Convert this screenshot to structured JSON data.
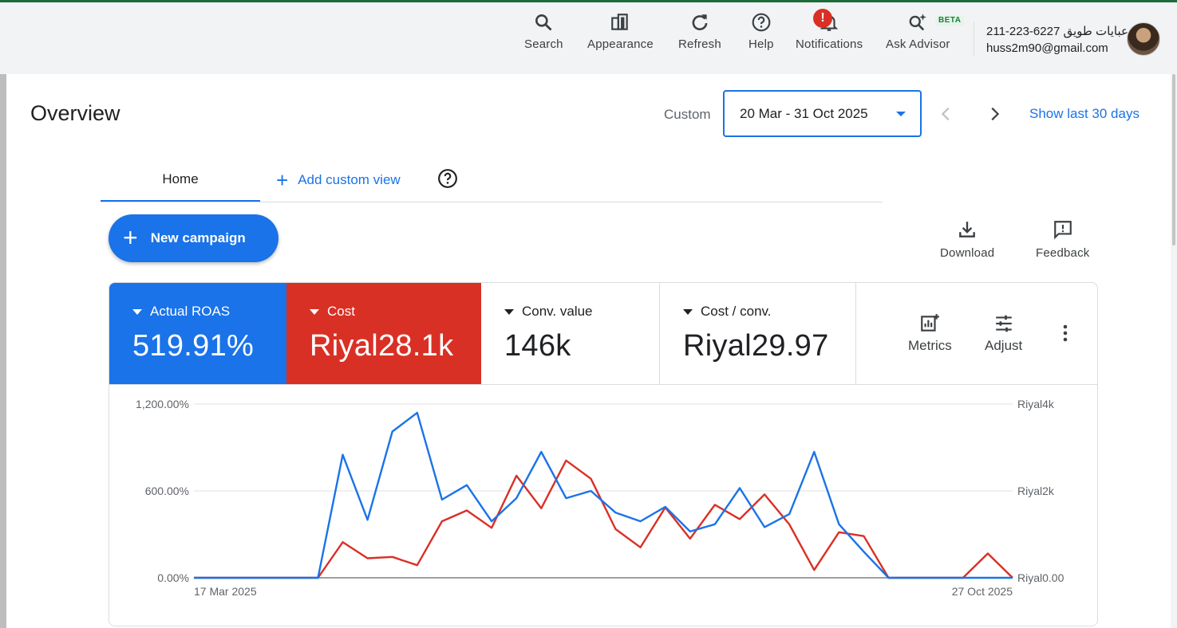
{
  "topbar": {
    "tools": [
      {
        "label": "Search",
        "icon": "search-icon"
      },
      {
        "label": "Appearance",
        "icon": "appearance-icon"
      },
      {
        "label": "Refresh",
        "icon": "refresh-icon"
      },
      {
        "label": "Help",
        "icon": "help-icon"
      },
      {
        "label": "Notifications",
        "icon": "bell-icon",
        "alert": "!"
      },
      {
        "label": "Ask Advisor",
        "icon": "advisor-icon",
        "badge": "BETA"
      }
    ],
    "account": {
      "name": "211-223-6227 عبايات طويق",
      "email": "huss2m90@gmail.com"
    }
  },
  "page": {
    "title": "Overview",
    "date_range_label": "Custom",
    "date_range_value": "20 Mar - 31 Oct 2025",
    "show_last": "Show last 30 days"
  },
  "tabs": {
    "home": "Home",
    "add_custom": "Add custom view"
  },
  "actions": {
    "new_campaign": "New campaign",
    "download": "Download",
    "feedback": "Feedback"
  },
  "kpis": [
    {
      "name": "Actual ROAS",
      "value": "519.91%",
      "color": "#1a73e8"
    },
    {
      "name": "Cost",
      "value": "Riyal28.1k",
      "color": "#d93025"
    },
    {
      "name": "Conv. value",
      "value": "146k"
    },
    {
      "name": "Cost / conv.",
      "value": "Riyal29.97"
    }
  ],
  "card_tools": {
    "metrics": "Metrics",
    "adjust": "Adjust"
  },
  "chart_data": {
    "type": "line",
    "x_start_label": "17 Mar 2025",
    "x_end_label": "27 Oct 2025",
    "left_ticks": [
      "0.00%",
      "600.00%",
      "1,200.00%"
    ],
    "right_ticks": [
      "Riyal0.00",
      "Riyal2k",
      "Riyal4k"
    ],
    "ylim_left": [
      0,
      1200
    ],
    "ylim_right": [
      0,
      4000
    ],
    "grid": true,
    "series": [
      {
        "name": "Actual ROAS",
        "axis": "left",
        "color": "#1a73e8",
        "values": [
          0,
          0,
          0,
          0,
          0,
          0,
          850,
          400,
          1010,
          1140,
          540,
          640,
          390,
          550,
          870,
          550,
          600,
          450,
          390,
          490,
          320,
          370,
          620,
          350,
          440,
          870,
          370,
          180,
          0,
          0,
          0,
          0,
          0,
          0
        ]
      },
      {
        "name": "Cost",
        "axis": "right",
        "color": "#d93025",
        "values": [
          0,
          0,
          0,
          0,
          0,
          0,
          820,
          450,
          480,
          290,
          1300,
          1550,
          1150,
          2350,
          1600,
          2700,
          2280,
          1120,
          700,
          1620,
          900,
          1680,
          1350,
          1920,
          1230,
          180,
          1050,
          960,
          0,
          0,
          0,
          0,
          560,
          0
        ]
      }
    ]
  }
}
